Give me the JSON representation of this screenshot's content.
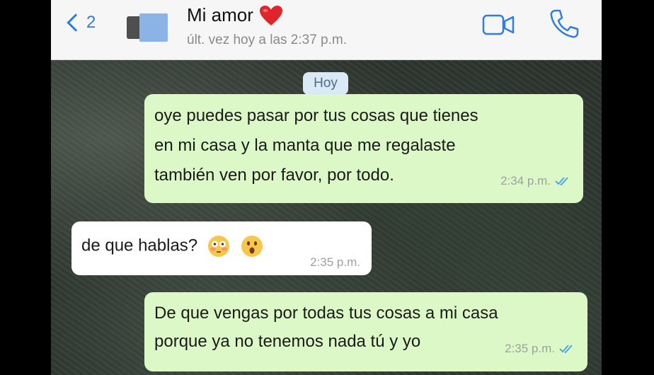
{
  "header": {
    "back_count": "2",
    "contact_name": "Mi amor",
    "last_seen": "últ. vez hoy a las 2:37 p.m.",
    "icons": [
      "chevron-left-icon",
      "avatar",
      "heart-icon",
      "video-call-icon",
      "phone-call-icon"
    ],
    "colors": {
      "accent": "#2f7de1",
      "heart": "#e0242b"
    }
  },
  "chat": {
    "day_label": "Hoy",
    "messages": [
      {
        "direction": "out",
        "lines": [
          "oye puedes pasar por tus cosas que tienes",
          "en mi casa y la manta que me regalaste",
          "también ven por favor, por todo."
        ],
        "time": "2:34 p.m.",
        "status": "read"
      },
      {
        "direction": "in",
        "text": "de que hablas?",
        "emojis": [
          "flushed-face-icon",
          "astonished-face-icon"
        ],
        "time": "2:35 p.m."
      },
      {
        "direction": "out",
        "lines": [
          "De que vengas por todas tus cosas a mi casa",
          "porque ya no tenemos nada tú y yo"
        ],
        "time": "2:35 p.m.",
        "status": "read"
      }
    ],
    "colors": {
      "outgoing": "#dcf8c6",
      "incoming": "#ffffff",
      "ticks": "#4fa8e6"
    }
  }
}
